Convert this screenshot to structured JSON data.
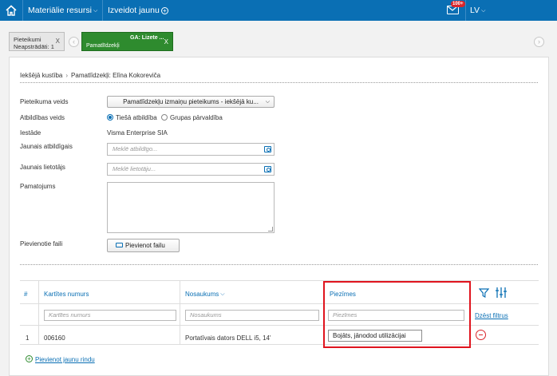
{
  "topbar": {
    "nav": [
      {
        "label": "Materiālie resursi"
      },
      {
        "label": "Izveidot jaunu"
      }
    ],
    "mail_badge": "100+",
    "language": "LV",
    "colors": {
      "bar": "#0a6fb4",
      "badge": "#d9262b"
    }
  },
  "tabs": {
    "pending": {
      "title": "Pieteikumi",
      "subtitle": "Neapstrādāti: 1",
      "close": "X"
    },
    "active": {
      "title": "GA: Lizete ...",
      "subtitle": "Pamatlīdzekļi",
      "close": "X"
    },
    "icons": [
      "chevron-left-icon",
      "chevron-right-icon"
    ]
  },
  "breadcrumb": {
    "part1": "Iekšējā kustība",
    "separator": "›",
    "part2": "Pamatlīdzekļi: Elīna Kokoreviča"
  },
  "form": {
    "request_type": {
      "label": "Pieteikuma veids",
      "value": "Pamatlīdzekļu izmaiņu pieteikums - iekšējā ku..."
    },
    "responsibility_type": {
      "label": "Atbildības veids",
      "options": [
        {
          "label": "Tiešā atbildība",
          "selected": true
        },
        {
          "label": "Grupas pārvaldība",
          "selected": false
        }
      ]
    },
    "institution": {
      "label": "Iestāde",
      "value": "Visma Enterprise SIA"
    },
    "new_responsible": {
      "label": "Jaunais atbildīgais",
      "placeholder": "Meklē atbildīgo..."
    },
    "new_user": {
      "label": "Jaunais lietotājs",
      "placeholder": "Meklē lietotāju..."
    },
    "justification": {
      "label": "Pamatojums",
      "value": ""
    },
    "attachments": {
      "label": "Pievienotie faili",
      "button": "Pievienot failu"
    }
  },
  "table": {
    "columns": [
      {
        "label": "#"
      },
      {
        "label": "Kartītes numurs",
        "filter_placeholder": "Kartītes numurs"
      },
      {
        "label": "Nosaukums",
        "filter_placeholder": "Nosaukums"
      },
      {
        "label": "Piezīmes",
        "filter_placeholder": "Piezīmes"
      }
    ],
    "clear_filters": "Dzēst filtrus",
    "rows": [
      {
        "index": "1",
        "card_number": "006160",
        "name": "Portatīvais dators DELL i5, 14'",
        "notes": "Bojāts, jānodod utilizācijai"
      }
    ],
    "add_row": "Pievienot jaunu rindu",
    "highlight_color": "#e0141e"
  }
}
